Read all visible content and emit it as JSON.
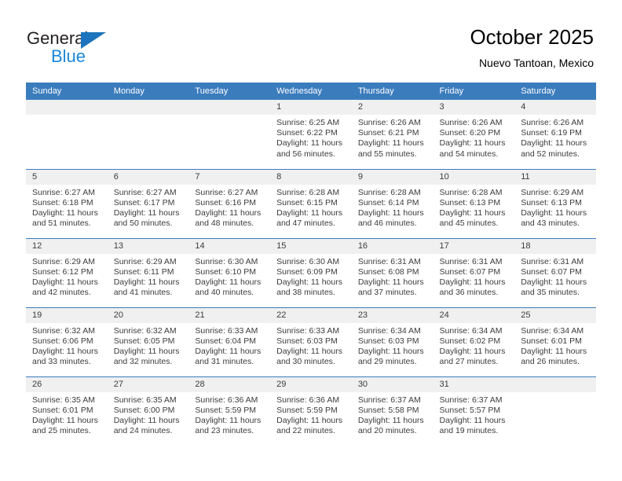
{
  "brand": {
    "name_part1": "General",
    "name_part2": "Blue",
    "triangle_icon": "triangle-logo-icon",
    "color_primary": "#1c75bc",
    "color_secondary": "#1c87d8"
  },
  "header": {
    "month_title": "October 2025",
    "location": "Nuevo Tantoan, Mexico"
  },
  "theme": {
    "header_row_bg": "#3b7cbd",
    "daynum_bg": "#f0f0f0",
    "text_color": "#3c3c3c"
  },
  "weekday_headers": [
    "Sunday",
    "Monday",
    "Tuesday",
    "Wednesday",
    "Thursday",
    "Friday",
    "Saturday"
  ],
  "weeks": [
    [
      {
        "day": "",
        "sunrise": "",
        "sunset": "",
        "daylight1": "",
        "daylight2": ""
      },
      {
        "day": "",
        "sunrise": "",
        "sunset": "",
        "daylight1": "",
        "daylight2": ""
      },
      {
        "day": "",
        "sunrise": "",
        "sunset": "",
        "daylight1": "",
        "daylight2": ""
      },
      {
        "day": "1",
        "sunrise": "Sunrise: 6:25 AM",
        "sunset": "Sunset: 6:22 PM",
        "daylight1": "Daylight: 11 hours",
        "daylight2": "and 56 minutes."
      },
      {
        "day": "2",
        "sunrise": "Sunrise: 6:26 AM",
        "sunset": "Sunset: 6:21 PM",
        "daylight1": "Daylight: 11 hours",
        "daylight2": "and 55 minutes."
      },
      {
        "day": "3",
        "sunrise": "Sunrise: 6:26 AM",
        "sunset": "Sunset: 6:20 PM",
        "daylight1": "Daylight: 11 hours",
        "daylight2": "and 54 minutes."
      },
      {
        "day": "4",
        "sunrise": "Sunrise: 6:26 AM",
        "sunset": "Sunset: 6:19 PM",
        "daylight1": "Daylight: 11 hours",
        "daylight2": "and 52 minutes."
      }
    ],
    [
      {
        "day": "5",
        "sunrise": "Sunrise: 6:27 AM",
        "sunset": "Sunset: 6:18 PM",
        "daylight1": "Daylight: 11 hours",
        "daylight2": "and 51 minutes."
      },
      {
        "day": "6",
        "sunrise": "Sunrise: 6:27 AM",
        "sunset": "Sunset: 6:17 PM",
        "daylight1": "Daylight: 11 hours",
        "daylight2": "and 50 minutes."
      },
      {
        "day": "7",
        "sunrise": "Sunrise: 6:27 AM",
        "sunset": "Sunset: 6:16 PM",
        "daylight1": "Daylight: 11 hours",
        "daylight2": "and 48 minutes."
      },
      {
        "day": "8",
        "sunrise": "Sunrise: 6:28 AM",
        "sunset": "Sunset: 6:15 PM",
        "daylight1": "Daylight: 11 hours",
        "daylight2": "and 47 minutes."
      },
      {
        "day": "9",
        "sunrise": "Sunrise: 6:28 AM",
        "sunset": "Sunset: 6:14 PM",
        "daylight1": "Daylight: 11 hours",
        "daylight2": "and 46 minutes."
      },
      {
        "day": "10",
        "sunrise": "Sunrise: 6:28 AM",
        "sunset": "Sunset: 6:13 PM",
        "daylight1": "Daylight: 11 hours",
        "daylight2": "and 45 minutes."
      },
      {
        "day": "11",
        "sunrise": "Sunrise: 6:29 AM",
        "sunset": "Sunset: 6:13 PM",
        "daylight1": "Daylight: 11 hours",
        "daylight2": "and 43 minutes."
      }
    ],
    [
      {
        "day": "12",
        "sunrise": "Sunrise: 6:29 AM",
        "sunset": "Sunset: 6:12 PM",
        "daylight1": "Daylight: 11 hours",
        "daylight2": "and 42 minutes."
      },
      {
        "day": "13",
        "sunrise": "Sunrise: 6:29 AM",
        "sunset": "Sunset: 6:11 PM",
        "daylight1": "Daylight: 11 hours",
        "daylight2": "and 41 minutes."
      },
      {
        "day": "14",
        "sunrise": "Sunrise: 6:30 AM",
        "sunset": "Sunset: 6:10 PM",
        "daylight1": "Daylight: 11 hours",
        "daylight2": "and 40 minutes."
      },
      {
        "day": "15",
        "sunrise": "Sunrise: 6:30 AM",
        "sunset": "Sunset: 6:09 PM",
        "daylight1": "Daylight: 11 hours",
        "daylight2": "and 38 minutes."
      },
      {
        "day": "16",
        "sunrise": "Sunrise: 6:31 AM",
        "sunset": "Sunset: 6:08 PM",
        "daylight1": "Daylight: 11 hours",
        "daylight2": "and 37 minutes."
      },
      {
        "day": "17",
        "sunrise": "Sunrise: 6:31 AM",
        "sunset": "Sunset: 6:07 PM",
        "daylight1": "Daylight: 11 hours",
        "daylight2": "and 36 minutes."
      },
      {
        "day": "18",
        "sunrise": "Sunrise: 6:31 AM",
        "sunset": "Sunset: 6:07 PM",
        "daylight1": "Daylight: 11 hours",
        "daylight2": "and 35 minutes."
      }
    ],
    [
      {
        "day": "19",
        "sunrise": "Sunrise: 6:32 AM",
        "sunset": "Sunset: 6:06 PM",
        "daylight1": "Daylight: 11 hours",
        "daylight2": "and 33 minutes."
      },
      {
        "day": "20",
        "sunrise": "Sunrise: 6:32 AM",
        "sunset": "Sunset: 6:05 PM",
        "daylight1": "Daylight: 11 hours",
        "daylight2": "and 32 minutes."
      },
      {
        "day": "21",
        "sunrise": "Sunrise: 6:33 AM",
        "sunset": "Sunset: 6:04 PM",
        "daylight1": "Daylight: 11 hours",
        "daylight2": "and 31 minutes."
      },
      {
        "day": "22",
        "sunrise": "Sunrise: 6:33 AM",
        "sunset": "Sunset: 6:03 PM",
        "daylight1": "Daylight: 11 hours",
        "daylight2": "and 30 minutes."
      },
      {
        "day": "23",
        "sunrise": "Sunrise: 6:34 AM",
        "sunset": "Sunset: 6:03 PM",
        "daylight1": "Daylight: 11 hours",
        "daylight2": "and 29 minutes."
      },
      {
        "day": "24",
        "sunrise": "Sunrise: 6:34 AM",
        "sunset": "Sunset: 6:02 PM",
        "daylight1": "Daylight: 11 hours",
        "daylight2": "and 27 minutes."
      },
      {
        "day": "25",
        "sunrise": "Sunrise: 6:34 AM",
        "sunset": "Sunset: 6:01 PM",
        "daylight1": "Daylight: 11 hours",
        "daylight2": "and 26 minutes."
      }
    ],
    [
      {
        "day": "26",
        "sunrise": "Sunrise: 6:35 AM",
        "sunset": "Sunset: 6:01 PM",
        "daylight1": "Daylight: 11 hours",
        "daylight2": "and 25 minutes."
      },
      {
        "day": "27",
        "sunrise": "Sunrise: 6:35 AM",
        "sunset": "Sunset: 6:00 PM",
        "daylight1": "Daylight: 11 hours",
        "daylight2": "and 24 minutes."
      },
      {
        "day": "28",
        "sunrise": "Sunrise: 6:36 AM",
        "sunset": "Sunset: 5:59 PM",
        "daylight1": "Daylight: 11 hours",
        "daylight2": "and 23 minutes."
      },
      {
        "day": "29",
        "sunrise": "Sunrise: 6:36 AM",
        "sunset": "Sunset: 5:59 PM",
        "daylight1": "Daylight: 11 hours",
        "daylight2": "and 22 minutes."
      },
      {
        "day": "30",
        "sunrise": "Sunrise: 6:37 AM",
        "sunset": "Sunset: 5:58 PM",
        "daylight1": "Daylight: 11 hours",
        "daylight2": "and 20 minutes."
      },
      {
        "day": "31",
        "sunrise": "Sunrise: 6:37 AM",
        "sunset": "Sunset: 5:57 PM",
        "daylight1": "Daylight: 11 hours",
        "daylight2": "and 19 minutes."
      },
      {
        "day": "",
        "sunrise": "",
        "sunset": "",
        "daylight1": "",
        "daylight2": ""
      }
    ]
  ]
}
